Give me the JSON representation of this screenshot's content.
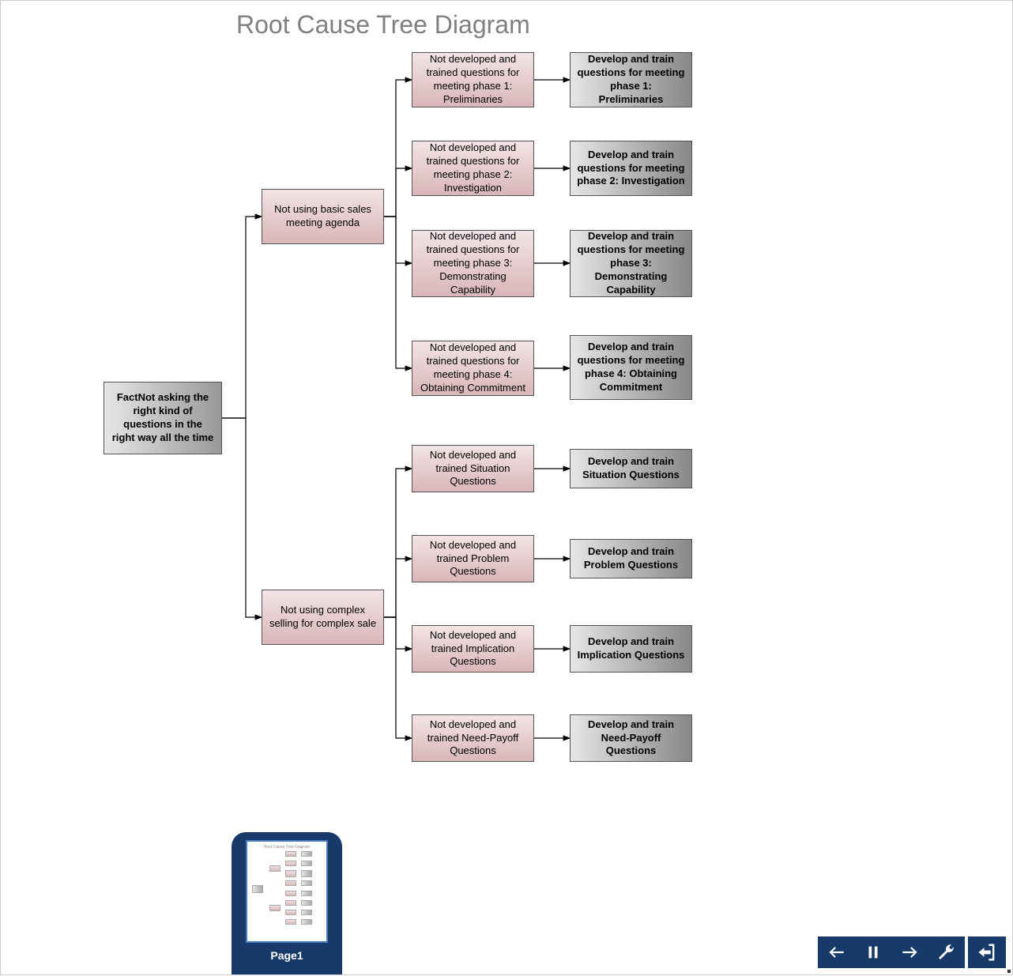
{
  "title": "Root Cause Tree Diagram",
  "root": "FactNot asking the right kind of questions in the right way\nall the time",
  "cause1": "Not using basic sales meeting agenda",
  "cause2": "Not using complex selling for complex sale",
  "sub": {
    "s1": "Not developed and trained questions for meeting phase 1: Preliminaries",
    "s2": "Not developed and trained questions for meeting phase 2: Investigation",
    "s3": "Not developed and trained questions for meeting phase 3: Demonstrating Capability",
    "s4": "Not developed and trained questions for meeting phase 4: Obtaining Commitment",
    "s5": "Not developed and trained Situation Questions",
    "s6": "Not developed and trained Problem Questions",
    "s7": "Not developed and trained Implication Questions",
    "s8": "Not developed and trained Need-Payoff Questions"
  },
  "action": {
    "a1": "Develop and train questions for meeting phase 1: Preliminaries",
    "a2": "Develop and train questions for meeting phase 2: Investigation",
    "a3": "Develop and train questions for meeting phase 3: Demonstrating Capability",
    "a4": "Develop and train questions for meeting phase 4: Obtaining Commitment",
    "a5": "Develop and train Situation Questions",
    "a6": "Develop and train Problem Questions",
    "a7": "Develop and train Implication Questions",
    "a8": "Develop and train Need-Payoff Questions"
  },
  "pageLabel": "Page1"
}
